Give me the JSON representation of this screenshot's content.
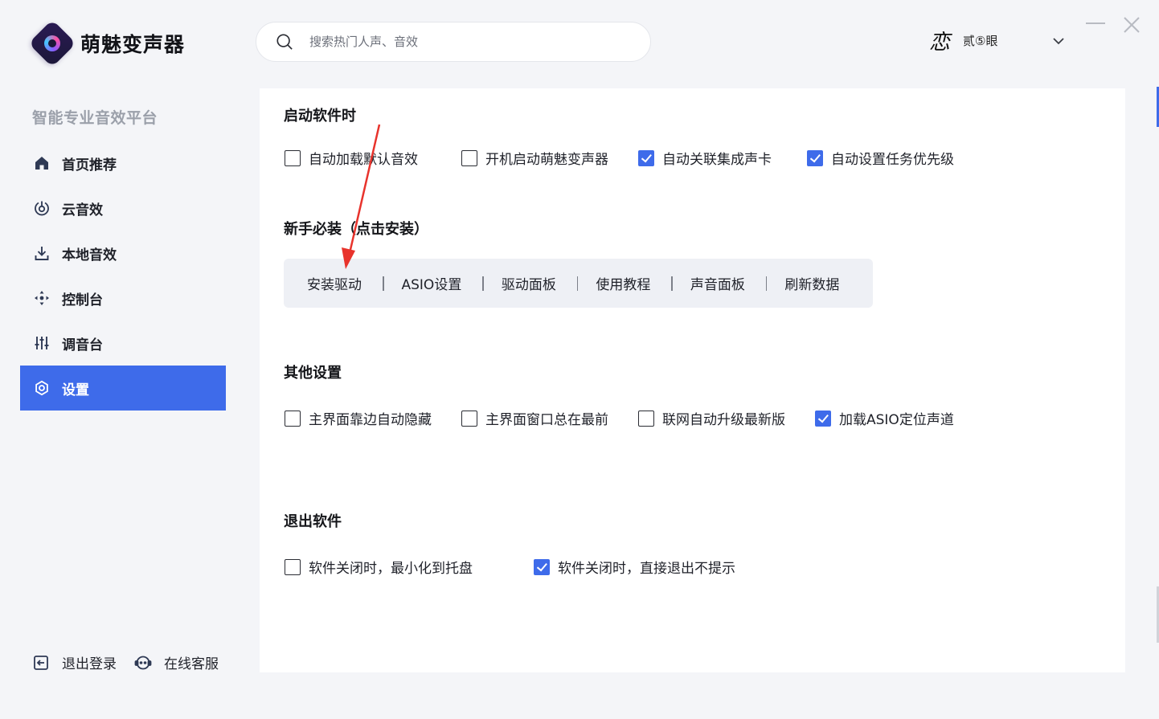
{
  "app": {
    "name": "萌魅变声器",
    "tagline": "智能专业音效平台"
  },
  "search": {
    "placeholder": "搜索热门人声、音效"
  },
  "user": {
    "avatar_glyph": "恋",
    "name": "贰⑤眼"
  },
  "sidebar": {
    "items": [
      {
        "label": "首页推荐",
        "icon": "home-icon",
        "active": false
      },
      {
        "label": "云音效",
        "icon": "cloud-sound-icon",
        "active": false
      },
      {
        "label": "本地音效",
        "icon": "download-icon",
        "active": false
      },
      {
        "label": "控制台",
        "icon": "move-arrows-icon",
        "active": false
      },
      {
        "label": "调音台",
        "icon": "mixer-sliders-icon",
        "active": false
      },
      {
        "label": "设置",
        "icon": "gear-icon",
        "active": true
      }
    ],
    "logout_label": "退出登录",
    "support_label": "在线客服"
  },
  "settings": {
    "startup": {
      "title": "启动软件时",
      "options": [
        {
          "label": "自动加载默认音效",
          "checked": false
        },
        {
          "label": "开机启动萌魅变声器",
          "checked": false
        },
        {
          "label": "自动关联集成声卡",
          "checked": true
        },
        {
          "label": "自动设置任务优先级",
          "checked": true
        }
      ]
    },
    "install": {
      "title": "新手必装（点击安装）",
      "buttons": [
        "安装驱动",
        "ASIO设置",
        "驱动面板",
        "使用教程",
        "声音面板",
        "刷新数据"
      ]
    },
    "other": {
      "title": "其他设置",
      "options": [
        {
          "label": "主界面靠边自动隐藏",
          "checked": false
        },
        {
          "label": "主界面窗口总在最前",
          "checked": false
        },
        {
          "label": "联网自动升级最新版",
          "checked": false
        },
        {
          "label": "加载ASIO定位声道",
          "checked": true
        }
      ]
    },
    "exit": {
      "title": "退出软件",
      "options": [
        {
          "label": "软件关闭时，最小化到托盘",
          "checked": false
        },
        {
          "label": "软件关闭时，直接退出不提示",
          "checked": true
        }
      ]
    }
  },
  "colors": {
    "accent": "#3e6bea",
    "annotation_arrow": "#e8332c"
  }
}
